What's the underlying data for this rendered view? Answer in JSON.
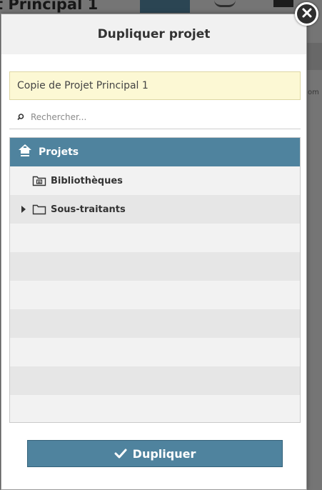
{
  "background": {
    "title": "t Principal 1",
    "side_text": "om"
  },
  "dialog": {
    "title": "Dupliquer projet",
    "name_value": "Copie de Projet Principal 1",
    "search_placeholder": "Rechercher...",
    "tree": {
      "root_label": "Projets",
      "items": [
        {
          "label": "Bibliothèques",
          "icon": "library-folder-icon",
          "expandable": false
        },
        {
          "label": "Sous-traitants",
          "icon": "folder-icon",
          "expandable": true
        }
      ]
    },
    "submit_label": "Dupliquer"
  },
  "colors": {
    "accent": "#4f839e",
    "input_bg": "#fcf8d4",
    "row_light": "#f2f2f2",
    "row_dark": "#e6e6e6"
  }
}
